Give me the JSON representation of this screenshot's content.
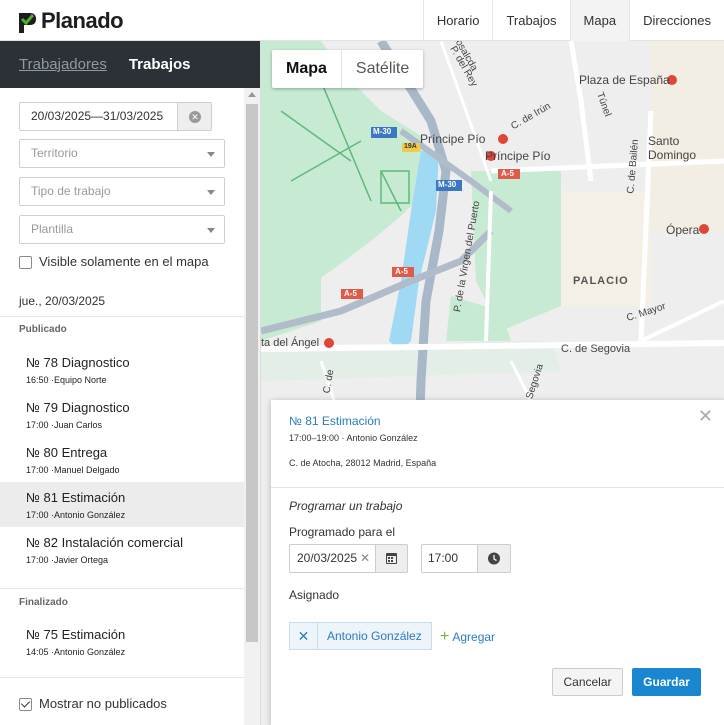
{
  "app": {
    "logo_text": "Planado"
  },
  "topnav": {
    "tabs": [
      {
        "label": "Horario"
      },
      {
        "label": "Trabajos"
      },
      {
        "label": "Mapa"
      },
      {
        "label": "Direcciones"
      }
    ],
    "active": "Mapa"
  },
  "sidebar": {
    "tabs": {
      "workers": "Trabajadores",
      "jobs": "Trabajos"
    },
    "date_range": "20/03/2025—31/03/2025",
    "territory_placeholder": "Territorio",
    "job_type_placeholder": "Tipo de trabajo",
    "template_placeholder": "Plantilla",
    "visible_on_map_label": "Visible solamente en el mapa",
    "visible_on_map_checked": false,
    "day_label": "jue., 20/03/2025",
    "published_label": "Publicado",
    "published_jobs": [
      {
        "title": "№ 78 Diagnostico",
        "sub": "16:50 ·Equipo Norte"
      },
      {
        "title": "№ 79 Diagnostico",
        "sub": "17:00 ·Juan Carlos"
      },
      {
        "title": "№ 80 Entrega",
        "sub": "17:00 ·Manuel Delgado"
      },
      {
        "title": "№ 81 Estimación",
        "sub": "17:00 ·Antonio González"
      },
      {
        "title": "№ 82 Instalación comercial",
        "sub": "17:00 ·Javier Ortega"
      }
    ],
    "finished_label": "Finalizado",
    "finished_jobs": [
      {
        "title": "№ 75 Estimación",
        "sub": "14:05 ·Antonio González"
      }
    ],
    "show_unpublished_label": "Mostrar no publicados",
    "show_unpublished_checked": true
  },
  "map": {
    "toggle": {
      "map": "Mapa",
      "satellite": "Satélite"
    },
    "labels": {
      "plaza_espana": "Plaza de España",
      "principe_pio_station": "Príncipe Pío",
      "principe_pio": "Príncipe Pío",
      "santo_domingo": "Santo Domingo",
      "opera": "Ópera",
      "palacio": "PALACIO",
      "c_segovia": "C. de Segovia",
      "c_mayor": "C. Mayor",
      "c_irun": "C. de Irún",
      "tunel": "Túnel",
      "c_bailen": "C. de Bailén",
      "virgen_puerto": "P. de la Virgen del Puerto",
      "del_angel": "ta del Ángel",
      "segovia_v": "Segovia",
      "c_de": "C. de",
      "rey": "P. del Rey",
      "ferraz": "Kosalcda",
      "m30a": "M-30",
      "m30b": "M-30",
      "a5a": "A-5",
      "a5b": "A-5",
      "a5c": "A-5",
      "r19a": "19A"
    }
  },
  "popup": {
    "title": "№ 81 Estimación",
    "time_worker": "17:00–19:00 · Antonio González",
    "address": "C. de Atocha, 28012 Madrid, España",
    "section": "Programar un trabajo",
    "scheduled_label": "Programado para el",
    "date_value": "20/03/2025",
    "time_value": "17:00",
    "assigned_label": "Asignado",
    "assignee": "Antonio González",
    "add_label": "Agregar",
    "cancel_label": "Cancelar",
    "save_label": "Guardar"
  },
  "colors": {
    "brand_green": "#4caf2f",
    "accent_blue": "#1a86d0",
    "link_blue": "#2b7bbf",
    "sidebar_header": "#2c3138",
    "park_green": "#c7ead3",
    "water_blue": "#9fd9f3"
  }
}
